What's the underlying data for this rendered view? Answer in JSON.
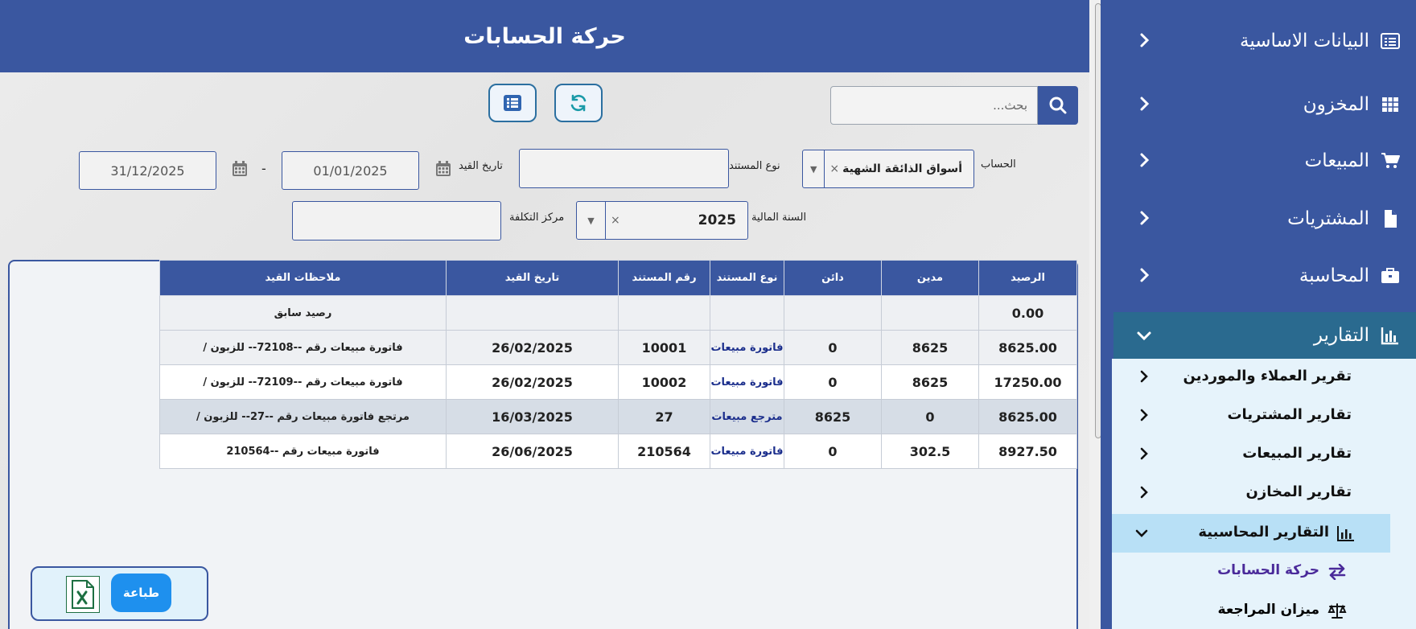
{
  "header": {
    "title": "حركة الحسابات"
  },
  "search": {
    "placeholder": "بحث..."
  },
  "filters": {
    "account_label": "الحساب",
    "account_value": "أسواق الذائقة الشهية",
    "doc_type_label": "نوع المستند",
    "date_label": "تاريخ القيد",
    "date_from": "01/01/2025",
    "date_separator": "-",
    "date_to": "31/12/2025",
    "fiscal_year_label": "السنة المالية",
    "fiscal_year_value": "2025",
    "cost_center_label": "مركز التكلفة",
    "clear_symbol": "×",
    "dropdown_symbol": "▼"
  },
  "table": {
    "columns": [
      "الرصيد",
      "مدين",
      "دائن",
      "نوع المستند",
      "رقم المستند",
      "تاريخ القيد",
      "ملاحظات القيد"
    ],
    "rows": [
      [
        "0.00",
        "",
        "",
        "",
        "",
        "",
        "رصيد سابق"
      ],
      [
        "8625.00",
        "8625",
        "0",
        "فاتورة مبيعات",
        "10001",
        "26/02/2025",
        "فاتورة مبيعات رقم --72108-- للزبون /"
      ],
      [
        "17250.00",
        "8625",
        "0",
        "فاتورة مبيعات",
        "10002",
        "26/02/2025",
        "فاتورة مبيعات رقم --72109-- للزبون /"
      ],
      [
        "8625.00",
        "0",
        "8625",
        "مترجع مبيعات",
        "27",
        "16/03/2025",
        "مرتجع فاتورة مبيعات رقم --27-- للزبون /"
      ],
      [
        "8927.50",
        "302.5",
        "0",
        "فاتورة مبيعات",
        "210564",
        "26/06/2025",
        "فاتورة مبيعات رقم --210564"
      ]
    ]
  },
  "actions": {
    "print_label": "طباعة"
  },
  "sidebar": {
    "items": [
      {
        "label": "البيانات الاساسية",
        "icon": "list-icon"
      },
      {
        "label": "المخزون",
        "icon": "grid-icon"
      },
      {
        "label": "المبيعات",
        "icon": "cart-icon"
      },
      {
        "label": "المشتريات",
        "icon": "file-icon"
      },
      {
        "label": "المحاسبة",
        "icon": "briefcase-icon"
      },
      {
        "label": "التقارير",
        "icon": "chart-icon"
      }
    ],
    "report_items": [
      {
        "label": "تقرير العملاء والموردين"
      },
      {
        "label": "تقارير المشتريات"
      },
      {
        "label": "تقارير المبيعات"
      },
      {
        "label": "تقارير المخازن"
      },
      {
        "label": "التقارير المحاسبية"
      }
    ],
    "accounting_items": [
      {
        "label": "حركة الحسابات",
        "icon": "exchange-icon",
        "color": "#4a2a9a"
      },
      {
        "label": "ميزان المراجعة",
        "icon": "balance-scale-icon",
        "color": "#111111"
      }
    ]
  },
  "colors": {
    "primary": "#3a57a0",
    "active_nav": "#2a6a8f",
    "submenu_bg": "#e6f3fb",
    "print_button": "#1e90ee"
  }
}
